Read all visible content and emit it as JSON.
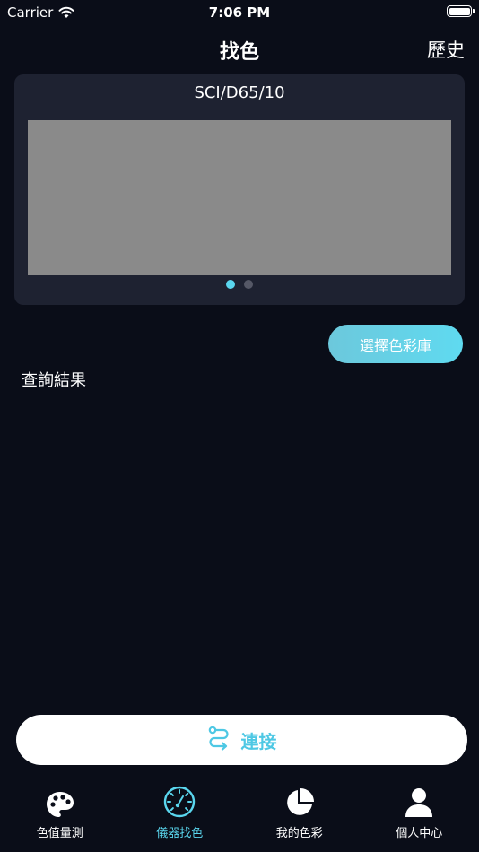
{
  "status_bar": {
    "carrier": "Carrier",
    "time": "7:06 PM"
  },
  "header": {
    "title": "找色",
    "history_label": "歷史"
  },
  "color_card": {
    "label": "SCI/D65/10",
    "swatch_color": "#8a8a8a",
    "page_count": 2,
    "active_page": 1
  },
  "select_library_label": "選擇色彩庫",
  "query_result_label": "查詢結果",
  "connect_label": "連接",
  "colors": {
    "accent": "#5ad6ee",
    "background": "#0a0d18",
    "card": "#1e2231"
  },
  "tabs": [
    {
      "label": "色值量測",
      "icon": "palette-icon",
      "active": false
    },
    {
      "label": "儀器找色",
      "icon": "gauge-icon",
      "active": true
    },
    {
      "label": "我的色彩",
      "icon": "pie-chart-icon",
      "active": false
    },
    {
      "label": "個人中心",
      "icon": "person-icon",
      "active": false
    }
  ]
}
